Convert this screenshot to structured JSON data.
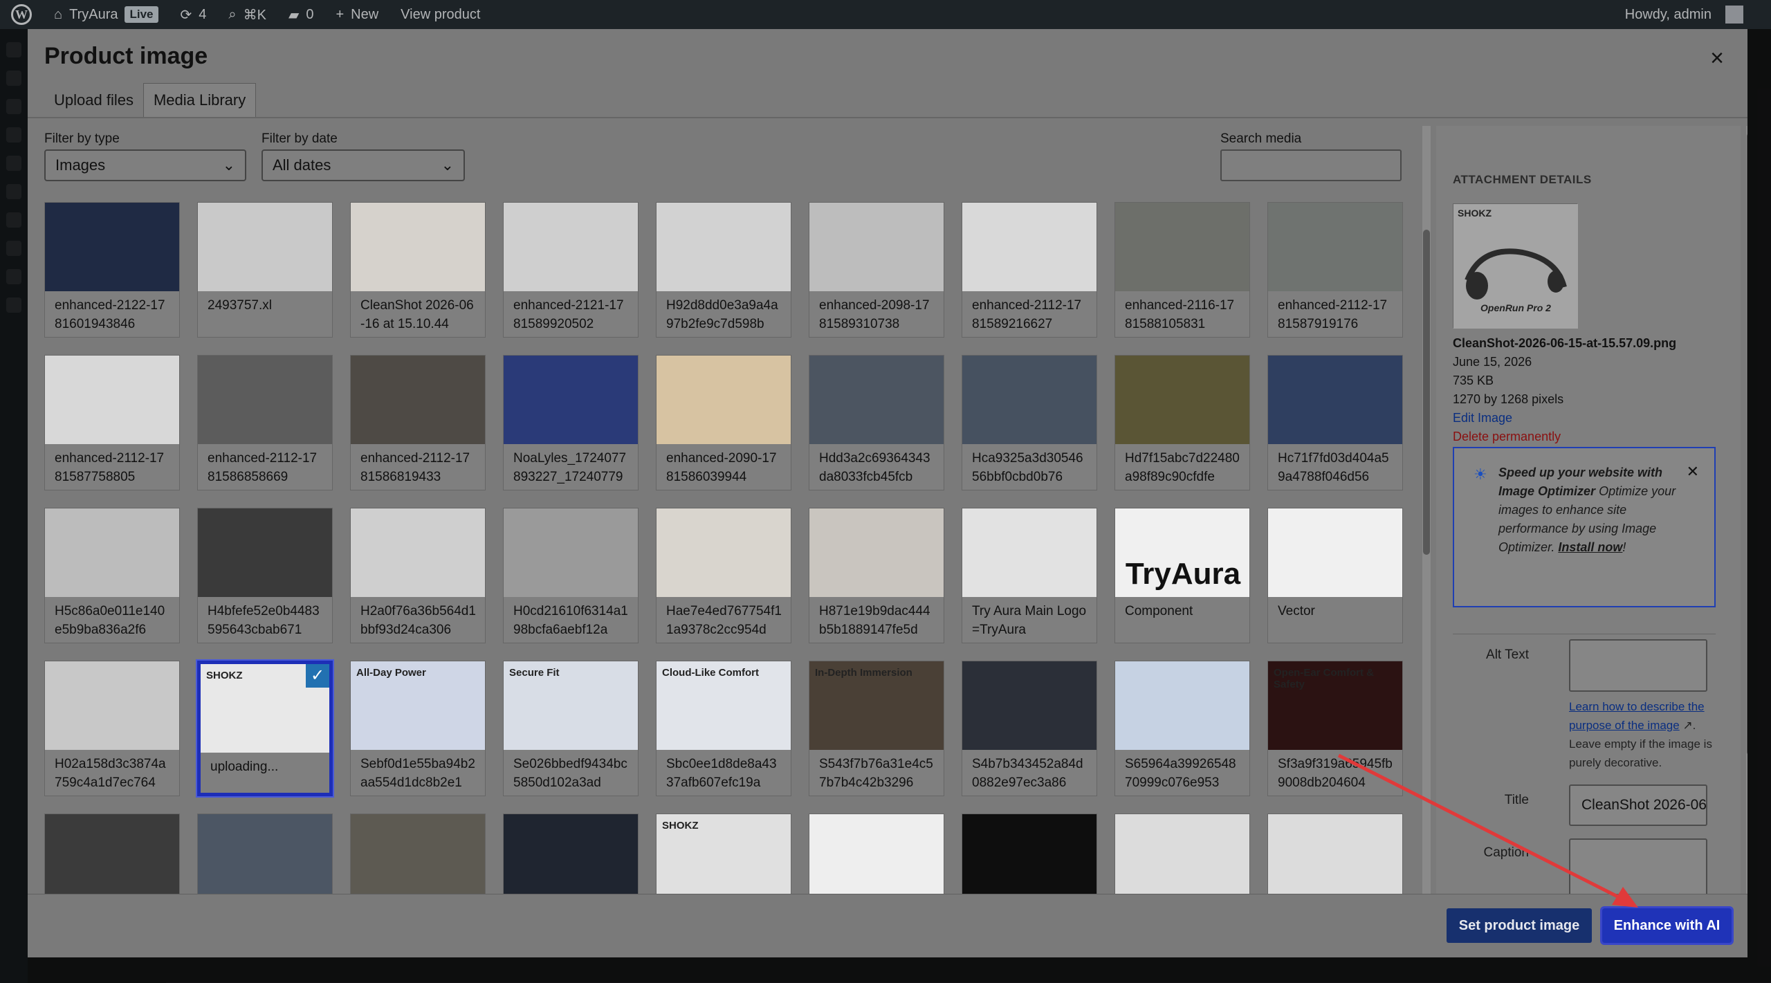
{
  "admin_bar": {
    "site_name": "TryAura",
    "live_badge": "Live",
    "updates_count": "4",
    "search_shortcut": "⌘K",
    "comments_count": "0",
    "new_label": "New",
    "view_product_label": "View product",
    "greeting": "Howdy, admin"
  },
  "modal": {
    "title": "Product image",
    "close_icon": "×",
    "tabs": [
      {
        "label": "Upload files",
        "active": false
      },
      {
        "label": "Media Library",
        "active": true
      }
    ]
  },
  "filters": {
    "type_label": "Filter by type",
    "type_value": "Images",
    "date_label": "Filter by date",
    "date_value": "All dates",
    "search_label": "Search media",
    "search_value": ""
  },
  "grid": {
    "rows": [
      [
        {
          "label": "enhanced-2122-1781601943846",
          "tone": "#1f2a44"
        },
        {
          "label": "2493757.xl",
          "tone": "#c9c9c9"
        },
        {
          "label": "CleanShot 2026-06-16 at 15.10.44",
          "tone": "#d6d2cc"
        },
        {
          "label": "enhanced-2121-1781589920502",
          "tone": "#cfcfcf"
        },
        {
          "label": "H92d8dd0e3a9a4a97b2fe9c7d598b",
          "tone": "#d2d2d2"
        },
        {
          "label": "enhanced-2098-1781589310738",
          "tone": "#bdbdbd"
        },
        {
          "label": "enhanced-2112-1781589216627",
          "tone": "#d9d9d9"
        },
        {
          "label": "enhanced-2116-1781588105831",
          "tone": "#6d6f6a"
        },
        {
          "label": "enhanced-2112-1781587919176",
          "tone": "#6f7370"
        }
      ],
      [
        {
          "label": "enhanced-2112-1781587758805",
          "tone": "#d8d8d8"
        },
        {
          "label": "enhanced-2112-1781586858669",
          "tone": "#5c5c5c"
        },
        {
          "label": "enhanced-2112-1781586819433",
          "tone": "#4e4a45"
        },
        {
          "label": "NoaLyles_1724077893227_17240779",
          "tone": "#2a3a78"
        },
        {
          "label": "enhanced-2090-1781586039944",
          "tone": "#d7c3a2"
        },
        {
          "label": "Hdd3a2c69364343da8033fcb45fcb",
          "tone": "#4c5561"
        },
        {
          "label": "Hca9325a3d3054656bbf0cbd0b76",
          "tone": "#465160"
        },
        {
          "label": "Hd7f15abc7d22480a98f89c90cfdfe",
          "tone": "#5a5535"
        },
        {
          "label": "Hc71f7fd03d404a59a4788f046d56",
          "tone": "#2f3f60"
        }
      ],
      [
        {
          "label": "H5c86a0e011e140e5b9ba836a2f6",
          "tone": "#bcbcbc"
        },
        {
          "label": "H4bfefe52e0b4483595643cbab671",
          "tone": "#3a3a3a"
        },
        {
          "label": "H2a0f76a36b564d1bbf93d24ca306",
          "tone": "#cfcfcf"
        },
        {
          "label": "H0cd21610f6314a198bcfa6aebf12a",
          "tone": "#9a9a9a"
        },
        {
          "label": "Hae7e4ed767754f11a9378c2cc954d",
          "tone": "#d9d5ce"
        },
        {
          "label": "H871e19b9dac444b5b1889147fe5d",
          "tone": "#c9c5bf"
        },
        {
          "label": "Try Aura Main Logo=TryAura",
          "tone": "#e2e2e2"
        },
        {
          "label": "Component",
          "tone": "#f0f0f0",
          "brand": "TryAura"
        },
        {
          "label": "Vector",
          "tone": "#f0f0f0"
        }
      ],
      [
        {
          "label": "H02a158d3c3874a759c4a1d7ec764",
          "tone": "#c8c8c8"
        },
        {
          "label": "uploading...",
          "tone": "#e8e8e8",
          "selected": true,
          "overlay": "SHOKZ"
        },
        {
          "label": "Sebf0d1e55ba94b2aa554d1dc8b2e1",
          "tone": "#cfd6e6",
          "overlay": "All-Day Power"
        },
        {
          "label": "Se026bbedf9434bc5850d102a3ad",
          "tone": "#d8dde6",
          "overlay": "Secure Fit"
        },
        {
          "label": "Sbc0ee1d8de8a4337afb607efc19a",
          "tone": "#e1e4ea",
          "overlay": "Cloud-Like Comfort"
        },
        {
          "label": "S543f7b76a31e4c57b7b4c42b3296",
          "tone": "#4a4036",
          "overlay": "In-Depth Immersion"
        },
        {
          "label": "S4b7b343452a84d0882e97ec3a86",
          "tone": "#2b2f38"
        },
        {
          "label": "S65964a3992654870999c076e953",
          "tone": "#c6d2e3"
        },
        {
          "label": "Sf3a9f319a65945fb9008db204604",
          "tone": "#2b1212",
          "overlay": "Open-Ear Comfort & Safety"
        }
      ],
      [
        {
          "label": "",
          "tone": "#3b3b3b"
        },
        {
          "label": "",
          "tone": "#4c5664"
        },
        {
          "label": "",
          "tone": "#5d5a52"
        },
        {
          "label": "",
          "tone": "#1f2530"
        },
        {
          "label": "",
          "tone": "#e0e0e0",
          "overlay": "SHOKZ"
        },
        {
          "label": "",
          "tone": "#eeeeee"
        },
        {
          "label": "",
          "tone": "#0e0e0e"
        },
        {
          "label": "",
          "tone": "#dcdcdc"
        },
        {
          "label": "",
          "tone": "#dcdcdc"
        }
      ]
    ]
  },
  "details": {
    "heading": "ATTACHMENT DETAILS",
    "thumb_brand": "SHOKZ",
    "thumb_caption": "OpenRun Pro 2",
    "filename": "CleanShot-2026-06-15-at-15.57.09.png",
    "date": "June 15, 2026",
    "size": "735 KB",
    "dimensions": "1270 by 1268 pixels",
    "edit_link": "Edit Image",
    "delete_link": "Delete permanently",
    "notice": {
      "title": "Speed up your website with Image Optimizer",
      "body": "Optimize your images to enhance site performance by using Image Optimizer.",
      "link": "Install now",
      "suffix": "!"
    },
    "alt_label": "Alt Text",
    "alt_value": "",
    "alt_help_link": "Learn how to describe the purpose of the image",
    "alt_help_text": "Leave empty if the image is purely decorative.",
    "title_label": "Title",
    "title_value": "CleanShot 2026-06-",
    "caption_label": "Caption",
    "caption_value": ""
  },
  "toolbar": {
    "set_label": "Set product image",
    "enhance_label": "Enhance with AI"
  },
  "colors": {
    "accent": "#1f33b8",
    "annotation_arrow": "#e03a3a",
    "notice_border": "#1f3fb3"
  }
}
